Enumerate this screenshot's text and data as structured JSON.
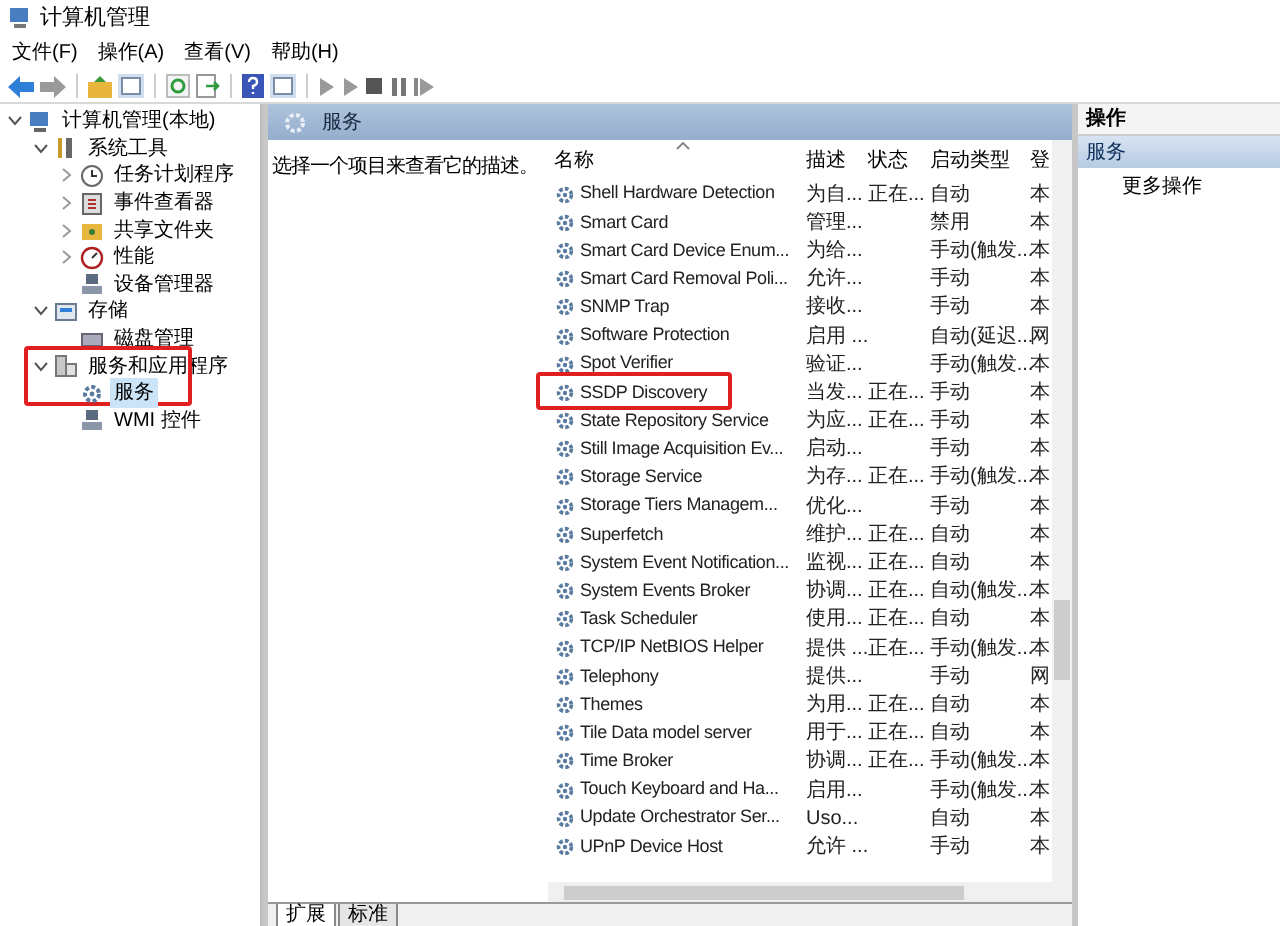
{
  "window": {
    "title": "计算机管理"
  },
  "menu": [
    "文件(F)",
    "操作(A)",
    "查看(V)",
    "帮助(H)"
  ],
  "tree": [
    {
      "label": "计算机管理(本地)",
      "kind": "computer",
      "expanded": true,
      "selected": false,
      "highlighted": false,
      "children": [
        {
          "label": "系统工具",
          "kind": "tools",
          "expanded": true,
          "selected": false,
          "highlighted": false,
          "children": [
            {
              "label": "任务计划程序",
              "kind": "clock",
              "expanded": false,
              "selected": false,
              "highlighted": false
            },
            {
              "label": "事件查看器",
              "kind": "log",
              "expanded": false,
              "selected": false,
              "highlighted": false
            },
            {
              "label": "共享文件夹",
              "kind": "folder",
              "expanded": false,
              "selected": false,
              "highlighted": false
            },
            {
              "label": "性能",
              "kind": "gauge",
              "expanded": false,
              "selected": false,
              "highlighted": false
            },
            {
              "label": "设备管理器",
              "kind": "device",
              "selected": false,
              "highlighted": false
            }
          ]
        },
        {
          "label": "存储",
          "kind": "storage",
          "expanded": true,
          "selected": false,
          "highlighted": false,
          "children": [
            {
              "label": "磁盘管理",
              "kind": "disk",
              "selected": false,
              "highlighted": false
            }
          ]
        },
        {
          "label": "服务和应用程序",
          "kind": "apps",
          "expanded": true,
          "selected": false,
          "highlighted": true,
          "children": [
            {
              "label": "服务",
              "kind": "gear",
              "selected": true,
              "highlighted": false
            },
            {
              "label": "WMI 控件",
              "kind": "device",
              "selected": false,
              "highlighted": false
            }
          ]
        }
      ]
    }
  ],
  "panel": {
    "title": "服务",
    "description": "选择一个项目来查看它的描述。"
  },
  "table": {
    "columns": [
      "名称",
      "描述",
      "状态",
      "启动类型",
      "登"
    ],
    "rows": [
      {
        "cells": [
          "Shell Hardware Detection",
          "为自...",
          "正在...",
          "自动",
          "本"
        ],
        "highlighted": false
      },
      {
        "cells": [
          "Smart Card",
          "管理...",
          "",
          "禁用",
          "本"
        ],
        "highlighted": false
      },
      {
        "cells": [
          "Smart Card Device Enum...",
          "为给...",
          "",
          "手动(触发...",
          "本"
        ],
        "highlighted": false
      },
      {
        "cells": [
          "Smart Card Removal Poli...",
          "允许...",
          "",
          "手动",
          "本"
        ],
        "highlighted": false
      },
      {
        "cells": [
          "SNMP Trap",
          "接收...",
          "",
          "手动",
          "本"
        ],
        "highlighted": false
      },
      {
        "cells": [
          "Software Protection",
          "启用 ...",
          "",
          "自动(延迟...",
          "网"
        ],
        "highlighted": false
      },
      {
        "cells": [
          "Spot Verifier",
          "验证...",
          "",
          "手动(触发...",
          "本"
        ],
        "highlighted": false
      },
      {
        "cells": [
          "SSDP Discovery",
          "当发...",
          "正在...",
          "手动",
          "本"
        ],
        "highlighted": true
      },
      {
        "cells": [
          "State Repository Service",
          "为应...",
          "正在...",
          "手动",
          "本"
        ],
        "highlighted": false
      },
      {
        "cells": [
          "Still Image Acquisition Ev...",
          "启动...",
          "",
          "手动",
          "本"
        ],
        "highlighted": false
      },
      {
        "cells": [
          "Storage Service",
          "为存...",
          "正在...",
          "手动(触发...",
          "本"
        ],
        "highlighted": false
      },
      {
        "cells": [
          "Storage Tiers Managem...",
          "优化...",
          "",
          "手动",
          "本"
        ],
        "highlighted": false
      },
      {
        "cells": [
          "Superfetch",
          "维护...",
          "正在...",
          "自动",
          "本"
        ],
        "highlighted": false
      },
      {
        "cells": [
          "System Event Notification...",
          "监视...",
          "正在...",
          "自动",
          "本"
        ],
        "highlighted": false
      },
      {
        "cells": [
          "System Events Broker",
          "协调...",
          "正在...",
          "自动(触发...",
          "本"
        ],
        "highlighted": false
      },
      {
        "cells": [
          "Task Scheduler",
          "使用...",
          "正在...",
          "自动",
          "本"
        ],
        "highlighted": false
      },
      {
        "cells": [
          "TCP/IP NetBIOS Helper",
          "提供 ...",
          "正在...",
          "手动(触发...",
          "本"
        ],
        "highlighted": false
      },
      {
        "cells": [
          "Telephony",
          "提供...",
          "",
          "手动",
          "网"
        ],
        "highlighted": false
      },
      {
        "cells": [
          "Themes",
          "为用...",
          "正在...",
          "自动",
          "本"
        ],
        "highlighted": false
      },
      {
        "cells": [
          "Tile Data model server",
          "用于...",
          "正在...",
          "自动",
          "本"
        ],
        "highlighted": false
      },
      {
        "cells": [
          "Time Broker",
          "协调...",
          "正在...",
          "手动(触发...",
          "本"
        ],
        "highlighted": false
      },
      {
        "cells": [
          "Touch Keyboard and Ha...",
          "启用...",
          "",
          "手动(触发...",
          "本"
        ],
        "highlighted": false
      },
      {
        "cells": [
          "Update Orchestrator Ser...",
          "Uso...",
          "",
          "自动",
          "本"
        ],
        "highlighted": false
      },
      {
        "cells": [
          "UPnP Device Host",
          "允许 ...",
          "",
          "手动",
          "本"
        ],
        "highlighted": false
      }
    ]
  },
  "bottom_tabs": [
    {
      "label": "扩展",
      "selected": true
    },
    {
      "label": "标准",
      "selected": false
    }
  ],
  "actions": {
    "title": "操作",
    "group": "服务",
    "items": [
      "更多操作"
    ]
  }
}
